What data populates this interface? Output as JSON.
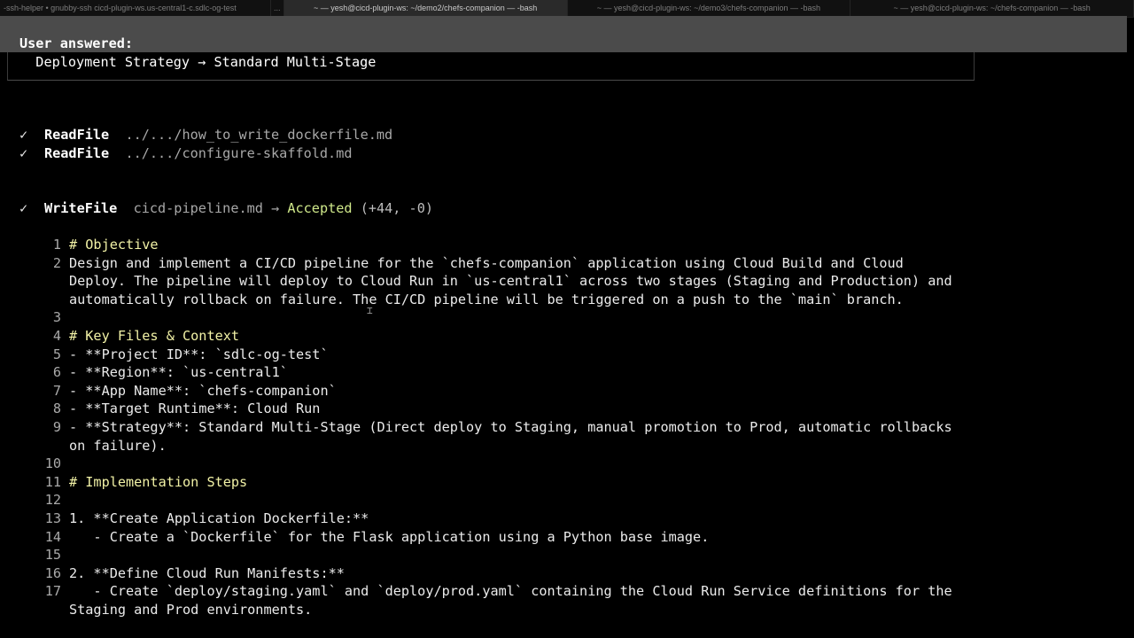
{
  "tabs": [
    {
      "label": "-ssh-helper • gnubby-ssh cicd-plugin-ws.us-central1-c.sdlc-og-test",
      "active": false
    },
    {
      "label": "...",
      "active": false
    },
    {
      "label": "~ — yesh@cicd-plugin-ws: ~/demo2/chefs-companion — -bash",
      "active": true
    },
    {
      "label": "~ — yesh@cicd-plugin-ws: ~/demo3/chefs-companion — -bash",
      "active": false
    },
    {
      "label": "~ — yesh@cicd-plugin-ws: ~/chefs-companion — -bash",
      "active": false
    }
  ],
  "answer": {
    "heading": "User answered:",
    "key": "Deployment Strategy",
    "arrow": "→",
    "value": "Standard Multi-Stage"
  },
  "tools": [
    {
      "check": "✓",
      "name": "ReadFile",
      "arg": "../.../how_to_write_dockerfile.md"
    },
    {
      "check": "✓",
      "name": "ReadFile",
      "arg": "../.../configure-skaffold.md"
    }
  ],
  "write": {
    "check": "✓",
    "name": "WriteFile",
    "file": "cicd-pipeline.md",
    "arrow": "→",
    "status": "Accepted",
    "diff": "(+44, -0)"
  },
  "code_lines": [
    {
      "n": "1",
      "t": "# Objective",
      "h": true
    },
    {
      "n": "2",
      "t": "Design and implement a CI/CD pipeline for the `chefs-companion` application using Cloud Build and Cloud"
    },
    {
      "n": "",
      "t": "Deploy. The pipeline will deploy to Cloud Run in `us-central1` across two stages (Staging and Production) and"
    },
    {
      "n": "",
      "t": "automatically rollback on failure. The CI/CD pipeline will be triggered on a push to the `main` branch."
    },
    {
      "n": "3",
      "t": ""
    },
    {
      "n": "4",
      "t": "# Key Files & Context",
      "h": true
    },
    {
      "n": "5",
      "t": "- **Project ID**: `sdlc-og-test`"
    },
    {
      "n": "6",
      "t": "- **Region**: `us-central1`"
    },
    {
      "n": "7",
      "t": "- **App Name**: `chefs-companion`"
    },
    {
      "n": "8",
      "t": "- **Target Runtime**: Cloud Run"
    },
    {
      "n": "9",
      "t": "- **Strategy**: Standard Multi-Stage (Direct deploy to Staging, manual promotion to Prod, automatic rollbacks"
    },
    {
      "n": "",
      "t": "on failure)."
    },
    {
      "n": "10",
      "t": ""
    },
    {
      "n": "11",
      "t": "# Implementation Steps",
      "h": true
    },
    {
      "n": "12",
      "t": ""
    },
    {
      "n": "13",
      "t": "1. **Create Application Dockerfile:**"
    },
    {
      "n": "14",
      "t": "   - Create a `Dockerfile` for the Flask application using a Python base image."
    },
    {
      "n": "15",
      "t": ""
    },
    {
      "n": "16",
      "t": "2. **Define Cloud Run Manifests:**"
    },
    {
      "n": "17",
      "t": "   - Create `deploy/staging.yaml` and `deploy/prod.yaml` containing the Cloud Run Service definitions for the"
    },
    {
      "n": "",
      "t": "Staging and Prod environments."
    }
  ],
  "colors": {
    "background": "#000000",
    "highlight": "#4b4b4b",
    "accepted": "#cfe88a",
    "heading": "#f2f2a6"
  },
  "cursor_icon": "text-cursor-icon"
}
